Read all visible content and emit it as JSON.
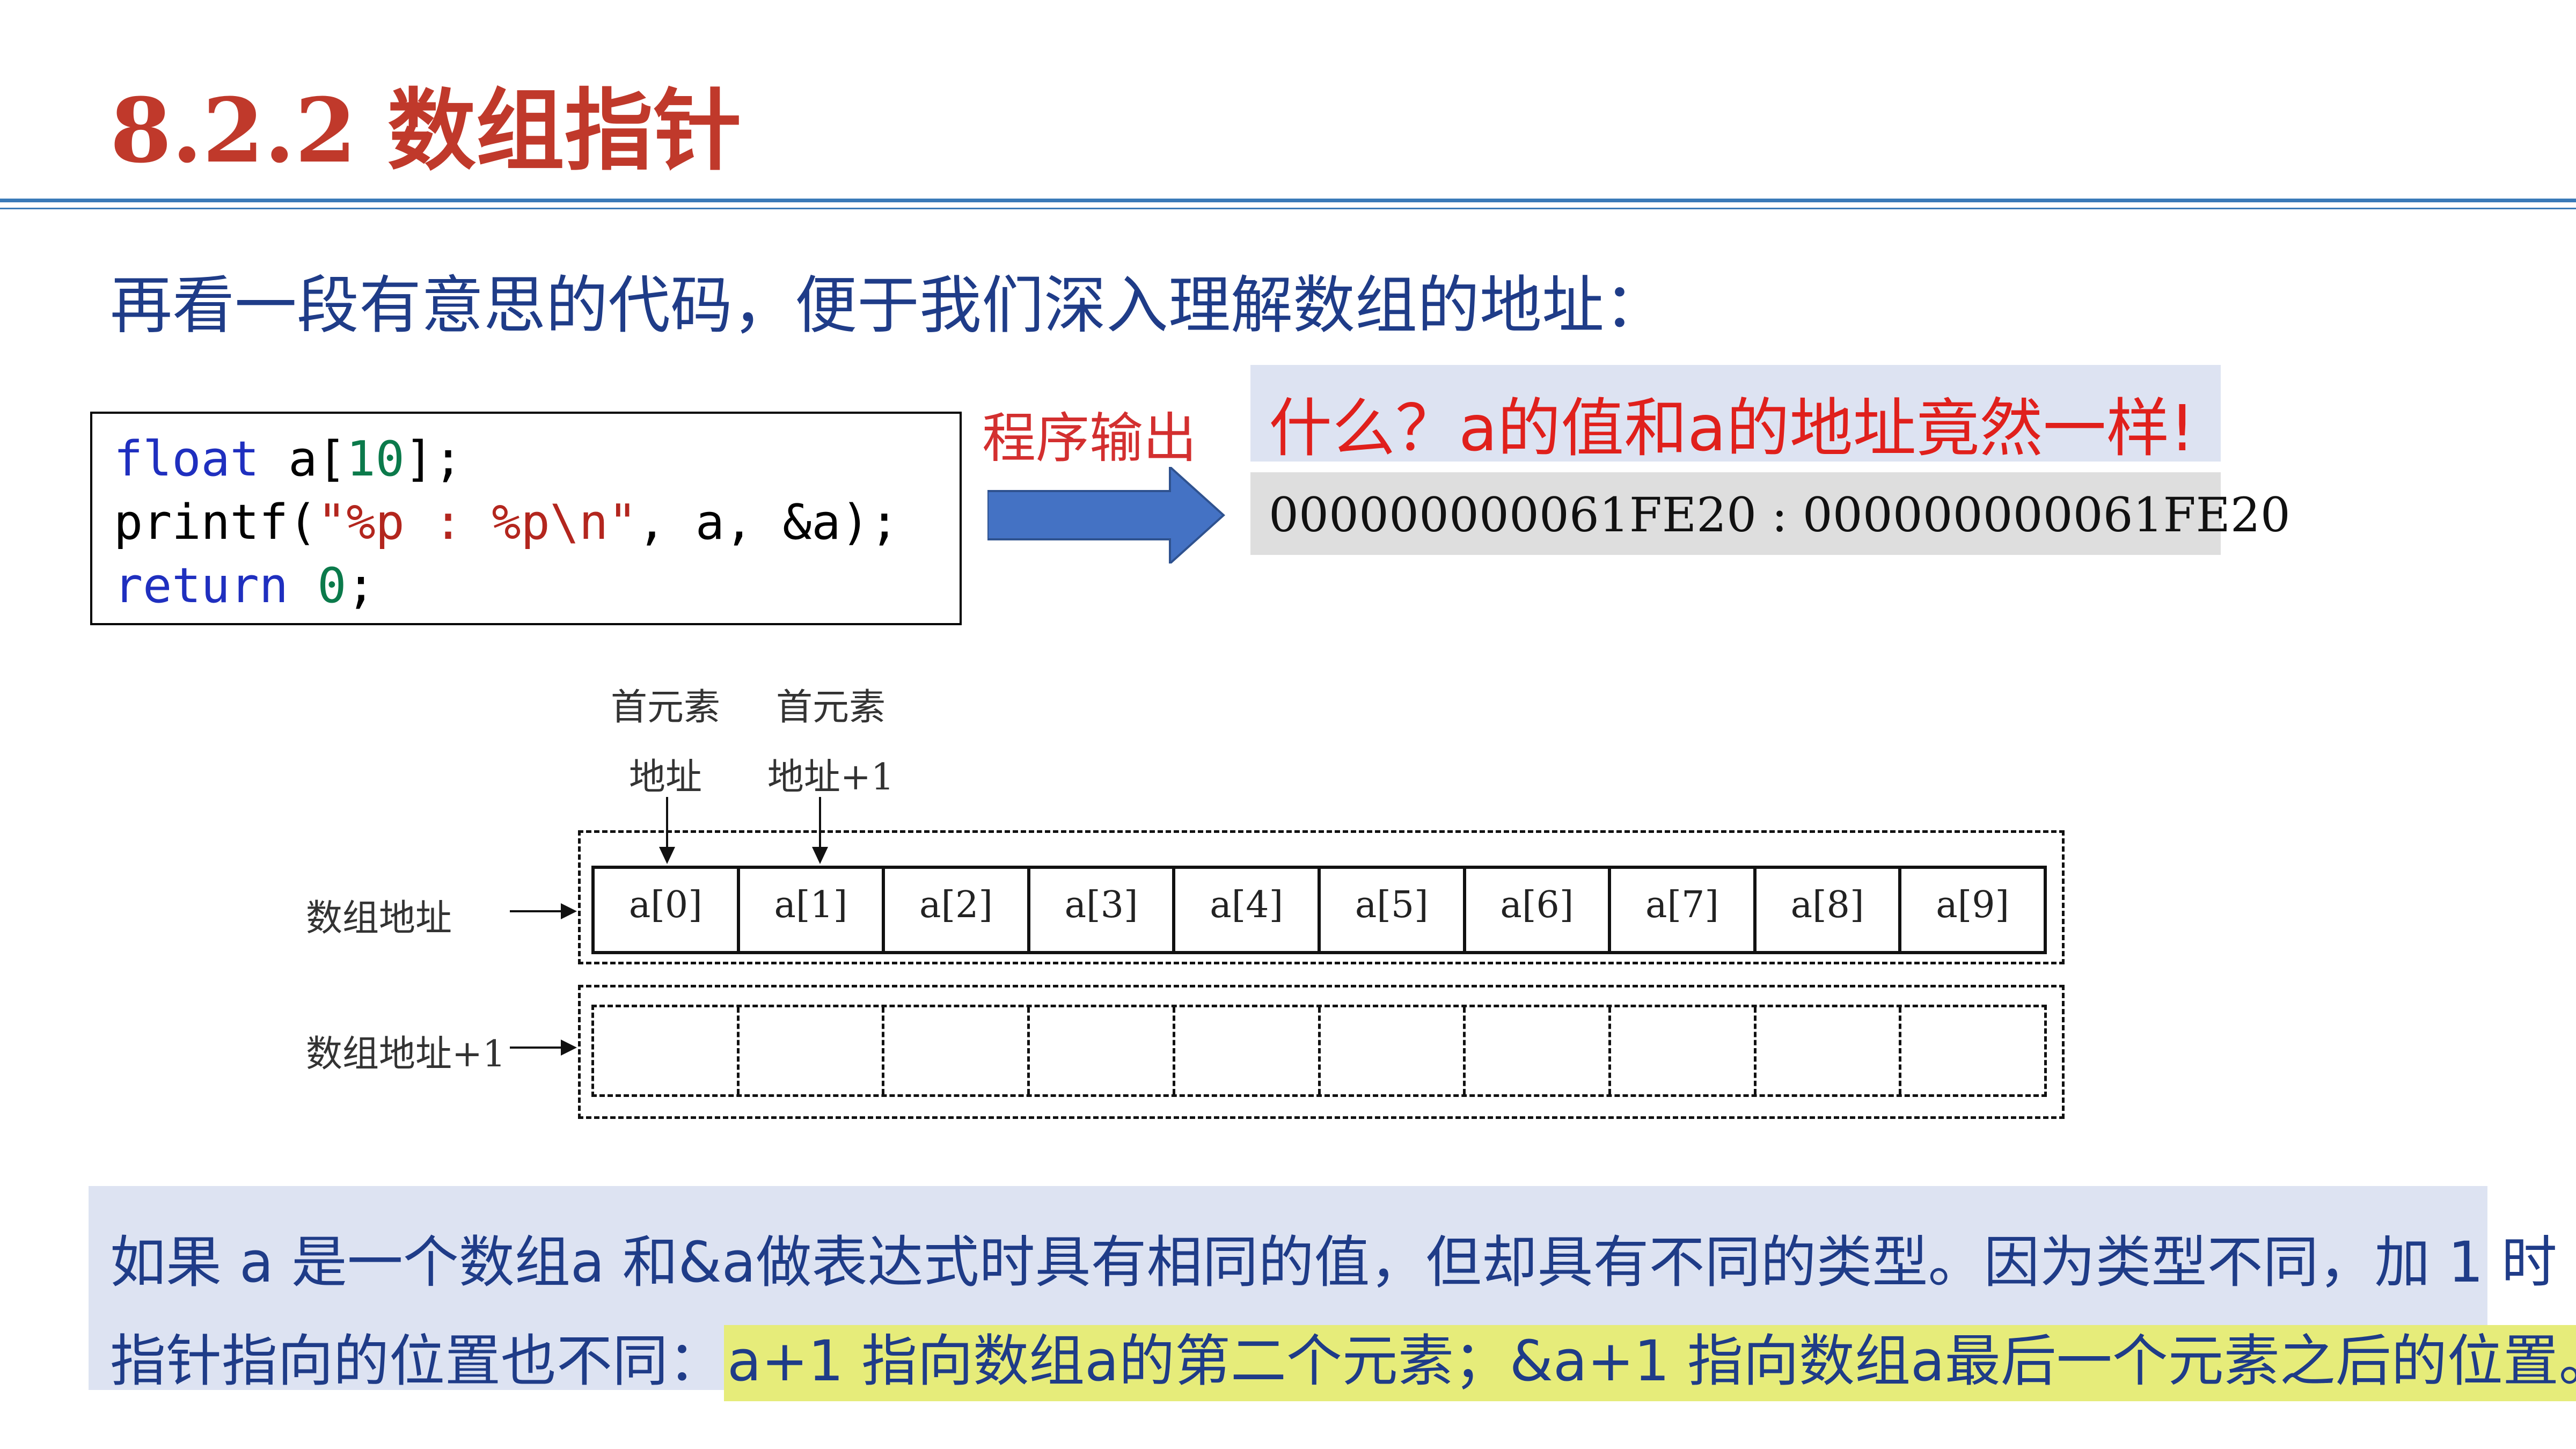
{
  "title": "8.2.2 数组指针",
  "intro": "再看一段有意思的代码，便于我们深入理解数组的地址：",
  "code": {
    "line1": {
      "kw": "float",
      "p1": " a[",
      "num": "10",
      "p2": "];"
    },
    "line2": {
      "p1": "printf(",
      "str": "\"%p : %p\\n\"",
      "p2": ", a, &a);"
    },
    "line3": {
      "kw": "return",
      "p1": " ",
      "num": "0",
      "p2": ";"
    }
  },
  "output_label": "程序输出",
  "surprise": "什么？a的值和a的地址竟然一样!",
  "output_value": "000000000061FE20 : 000000000061FE20",
  "diagram": {
    "pointer1_line1": "首元素",
    "pointer1_line2": "地址",
    "pointer2_line1": "首元素",
    "pointer2_line2": "地址+1",
    "row1_label": "数组地址",
    "row2_label": "数组地址+1",
    "cells": [
      "a[0]",
      "a[1]",
      "a[2]",
      "a[3]",
      "a[4]",
      "a[5]",
      "a[6]",
      "a[7]",
      "a[8]",
      "a[9]"
    ]
  },
  "explanation": {
    "line1": "如果 a 是一个数组a 和&a做表达式时具有相同的值，但却具有不同的类型。因为类型不同，加 1 时",
    "line2_plain": "指针指向的位置也不同：",
    "line2_highlight": "a+1 指向数组a的第二个元素；&a+1 指向数组a最后一个元素之后的位置。"
  },
  "colors": {
    "title": "#c0392b",
    "rule": "#3a7ab8",
    "body_text": "#1f3c88",
    "arrow": "#4472c4",
    "surprise_text": "#e0201c",
    "highlight": "#e6ec7a"
  }
}
